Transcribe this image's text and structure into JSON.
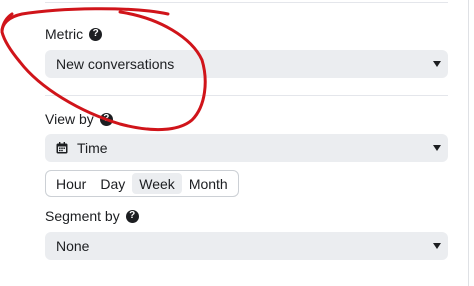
{
  "metric": {
    "label": "Metric",
    "value": "New conversations",
    "help_icon": "question-circle-icon"
  },
  "view_by": {
    "label": "View by",
    "value": "Time",
    "value_icon": "calendar-icon",
    "help_icon": "question-circle-icon",
    "granularity": {
      "options": [
        "Hour",
        "Day",
        "Week",
        "Month"
      ],
      "selected": "Week"
    }
  },
  "segment_by": {
    "label": "Segment by",
    "value": "None",
    "help_icon": "question-circle-icon"
  },
  "colors": {
    "annotation": "#d0141a",
    "field_bg": "#ebedf0"
  }
}
